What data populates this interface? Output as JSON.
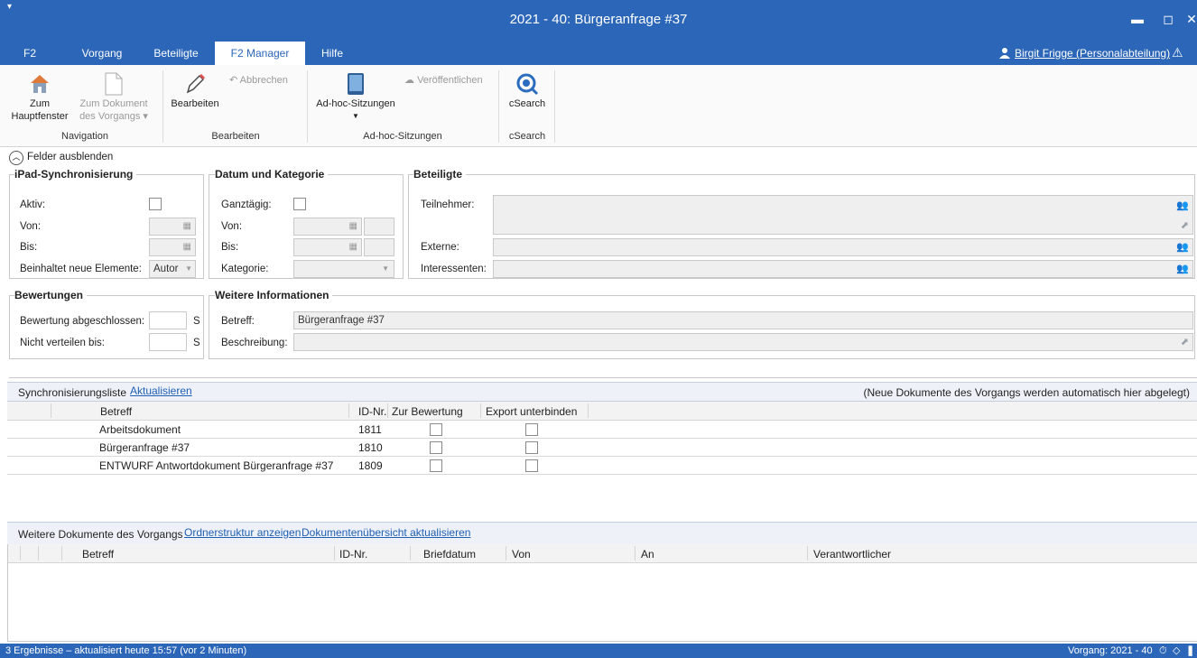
{
  "window": {
    "title": "2021 - 40: Bürgeranfrage #37",
    "quick_access": "▾",
    "minimize": "▬",
    "maximize": "◻",
    "close": "✕"
  },
  "menu": {
    "tabs": [
      "F2",
      "Vorgang",
      "Beteiligte",
      "F2 Manager",
      "Hilfe"
    ],
    "active": "F2 Manager",
    "user": "Birgit Frigge (Personalabteilung)"
  },
  "ribbon": {
    "zum_hauptfenster": [
      "Zum",
      "Hauptfenster"
    ],
    "zum_dokument": [
      "Zum Dokument",
      "des Vorgangs ▾"
    ],
    "bearbeiten": "Bearbeiten",
    "abbrechen": "Abbrechen",
    "adhoc": "Ad-hoc-Sitzungen",
    "veroeffentlichen": "Veröffentlichen",
    "csearch": "cSearch",
    "groups": {
      "navigation": "Navigation",
      "bearbeiten": "Bearbeiten",
      "adhoc": "Ad-hoc-Sitzungen",
      "csearch": "cSearch"
    }
  },
  "form": {
    "toggle": "Felder ausblenden",
    "ipad": {
      "title": "iPad-Synchronisierung",
      "aktiv": "Aktiv:",
      "von": "Von:",
      "bis": "Bis:",
      "beinhaltet": "Beinhaltet neue Elemente:",
      "beinhaltet_value": "Autor"
    },
    "datum": {
      "title": "Datum und Kategorie",
      "ganztaegig": "Ganztägig:",
      "von": "Von:",
      "bis": "Bis:",
      "kategorie": "Kategorie:"
    },
    "beteiligte": {
      "title": "Beteiligte",
      "teilnehmer": "Teilnehmer:",
      "externe": "Externe:",
      "interessenten": "Interessenten:"
    },
    "bewertungen": {
      "title": "Bewertungen",
      "abgeschlossen": "Bewertung abgeschlossen:",
      "nicht_verteilen": "Nicht verteilen bis:",
      "suffix": "S"
    },
    "weitere": {
      "title": "Weitere Informationen",
      "betreff": "Betreff:",
      "betreff_value": "Bürgeranfrage #37",
      "beschreibung": "Beschreibung:"
    }
  },
  "sync_list": {
    "title": "Synchronisierungsliste",
    "refresh": "Aktualisieren",
    "note": "(Neue Dokumente des Vorgangs werden automatisch hier abgelegt)",
    "columns": [
      "Betreff",
      "ID-Nr.",
      "Zur Bewertung",
      "Export unterbinden"
    ],
    "rows": [
      {
        "betreff": "Arbeitsdokument",
        "id": "1811"
      },
      {
        "betreff": "Bürgeranfrage #37",
        "id": "1810"
      },
      {
        "betreff": "ENTWURF Antwortdokument Bürgeranfrage #37",
        "id": "1809"
      }
    ]
  },
  "more_docs": {
    "title": "Weitere Dokumente des Vorgangs",
    "link1": "Ordnerstruktur anzeigen",
    "link2": "Dokumentenübersicht aktualisieren",
    "columns": [
      "Betreff",
      "ID-Nr.",
      "Briefdatum",
      "Von",
      "An",
      "Verantwortlicher"
    ]
  },
  "status": {
    "left": "3 Ergebnisse – aktualisiert heute 15:57 (vor 2 Minuten)",
    "right": "Vorgang: 2021 - 40"
  }
}
